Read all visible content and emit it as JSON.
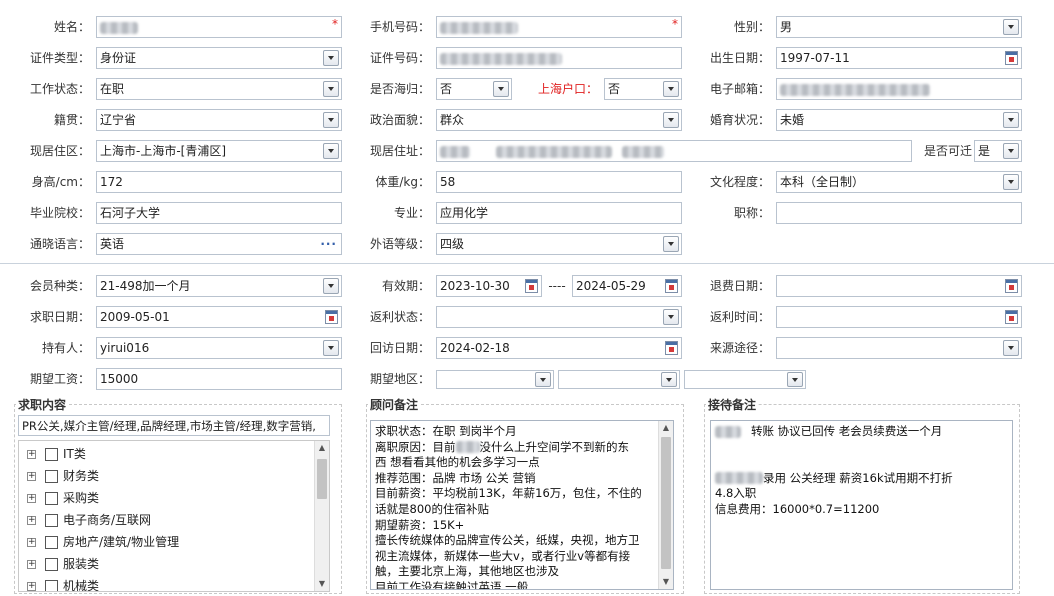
{
  "form": {
    "name": {
      "label": "姓名：",
      "required": "*"
    },
    "mobile": {
      "label": "手机号码：",
      "required": "*"
    },
    "gender": {
      "label": "性别：",
      "value": "男"
    },
    "id_type": {
      "label": "证件类型：",
      "value": "身份证"
    },
    "id_number": {
      "label": "证件号码："
    },
    "birthdate": {
      "label": "出生日期：",
      "value": "1997-07-11"
    },
    "work_status": {
      "label": "工作状态：",
      "value": "在职"
    },
    "returnee": {
      "label": "是否海归：",
      "value": "否"
    },
    "shanghai_hukou": {
      "label": "上海户口：",
      "value": "否"
    },
    "email": {
      "label": "电子邮箱："
    },
    "native_place": {
      "label": "籍贯：",
      "value": "辽宁省"
    },
    "political": {
      "label": "政治面貌：",
      "value": "群众"
    },
    "marital": {
      "label": "婚育状况：",
      "value": "未婚"
    },
    "residence_area": {
      "label": "现居住区：",
      "value": "上海市-上海市-[青浦区]"
    },
    "residence_address": {
      "label": "现居住址："
    },
    "relocate": {
      "label": "是否可迁",
      "value": "是"
    },
    "height": {
      "label": "身高/cm：",
      "value": "172"
    },
    "weight": {
      "label": "体重/kg：",
      "value": "58"
    },
    "education": {
      "label": "文化程度：",
      "value": "本科（全日制）"
    },
    "school": {
      "label": "毕业院校：",
      "value": "石河子大学"
    },
    "major": {
      "label": "专业：",
      "value": "应用化学"
    },
    "title": {
      "label": "职称：",
      "value": ""
    },
    "language": {
      "label": "通晓语言：",
      "value": "英语",
      "more": "···"
    },
    "language_level": {
      "label": "外语等级：",
      "value": "四级"
    }
  },
  "membership": {
    "type": {
      "label": "会员种类：",
      "value": "21-498加一个月"
    },
    "validity": {
      "label": "有效期：",
      "start": "2023-10-30",
      "dash": "----",
      "end": "2024-05-29"
    },
    "refund_date": {
      "label": "退费日期："
    },
    "job_date": {
      "label": "求职日期：",
      "value": "2009-05-01"
    },
    "rebate_status": {
      "label": "返利状态："
    },
    "rebate_time": {
      "label": "返利时间："
    },
    "holder": {
      "label": "持有人：",
      "value": "yirui016"
    },
    "visit_date": {
      "label": "回访日期：",
      "value": "2024-02-18"
    },
    "source": {
      "label": "来源途径："
    },
    "expected_salary": {
      "label": "期望工资：",
      "value": "15000"
    },
    "expected_region": {
      "label": "期望地区："
    }
  },
  "job_intent": {
    "title": "求职内容",
    "value": "PR公关,媒介主管/经理,品牌经理,市场主管/经理,数字营销,",
    "categories": [
      {
        "label": "IT类"
      },
      {
        "label": "财务类"
      },
      {
        "label": "采购类"
      },
      {
        "label": "电子商务/互联网"
      },
      {
        "label": "房地产/建筑/物业管理"
      },
      {
        "label": "服装类"
      },
      {
        "label": "机械类"
      }
    ]
  },
  "consultant_notes": {
    "title": "顾问备注",
    "lines": [
      {
        "pre": "求职状态：在职  到岗半个月",
        "post": ""
      },
      {
        "pre": "离职原因：目前",
        "post": "没什么上升空间学不到新的东"
      },
      {
        "pre": "西   想看看其他的机会多学习一点",
        "post": ""
      },
      {
        "pre": "推荐范围：品牌  市场  公关  营销",
        "post": ""
      },
      {
        "pre": "目前薪资：平均税前13K，年薪16万，包住，不住的",
        "post": ""
      },
      {
        "pre": "话就是800的住宿补贴",
        "post": ""
      },
      {
        "pre": "期望薪资：15K+",
        "post": ""
      },
      {
        "pre": "擅长传统媒体的品牌宣传公关，纸媒，央视，地方卫",
        "post": ""
      },
      {
        "pre": "视主流媒体，新媒体一些大v，或者行业v等都有接",
        "post": ""
      },
      {
        "pre": "触，主要北京上海，其他地区也涉及",
        "post": ""
      },
      {
        "pre": "目前工作没有接触过英语   一般",
        "post": ""
      }
    ]
  },
  "reception_notes": {
    "title": "接待备注",
    "lines": [
      {
        "pre": "",
        "post": "转账  协议已回传  老会员续费送一个月"
      },
      {
        "pre": "",
        "post": ""
      },
      {
        "pre": "",
        "post": ""
      },
      {
        "pre": "",
        "post": "录用   公关经理   薪资16k试用期不打折"
      },
      {
        "pre": "4.8入职",
        "post": ""
      },
      {
        "pre": "信息费用：16000*0.7=11200",
        "post": ""
      }
    ]
  }
}
